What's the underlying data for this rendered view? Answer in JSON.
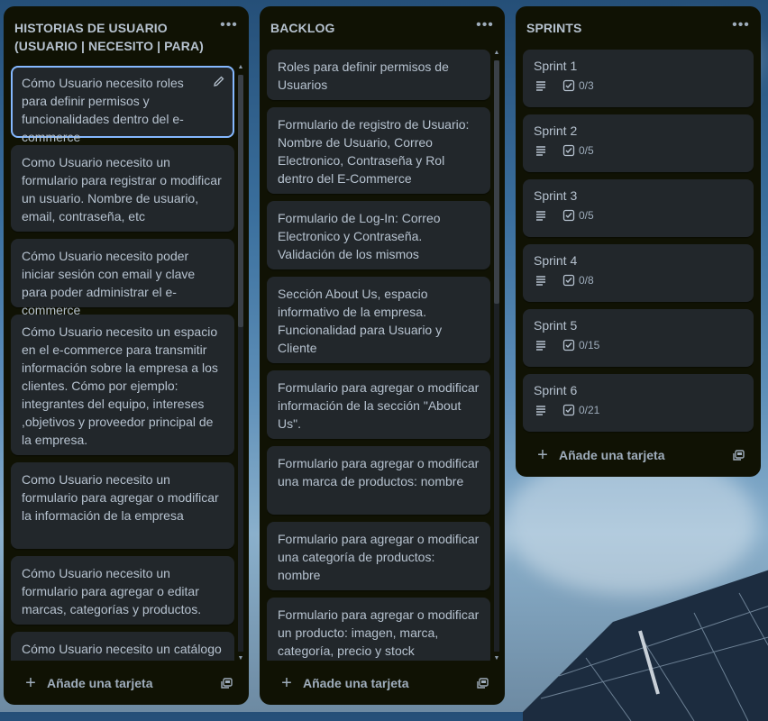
{
  "columns": [
    {
      "title": "HISTORIAS DE USUARIO (USUARIO | NECESITO | PARA)",
      "cards": [
        "Cómo Usuario necesito roles para definir permisos y funcionalidades dentro del e-commerce",
        "Como Usuario necesito un formulario para registrar o modificar un usuario. Nombre de usuario, email, contraseña, etc",
        "Cómo Usuario necesito poder iniciar sesión con email y clave para poder administrar el e-commerce",
        "Cómo Usuario necesito un espacio en el e-commerce para transmitir información sobre la empresa a los clientes. Cómo por ejemplo: integrantes del equipo, intereses ,objetivos y proveedor principal de la empresa.",
        "Como Usuario necesito un formulario para agregar o modificar la información de la empresa",
        "Cómo Usuario necesito un formulario para agregar o editar marcas, categorías y productos.",
        "Cómo Usuario necesito un catálogo con un listado de productos"
      ],
      "add_label": "Añade una tarjeta"
    },
    {
      "title": "BACKLOG",
      "cards": [
        "Roles para definir permisos de Usuarios",
        "Formulario de registro de Usuario: Nombre de Usuario, Correo Electronico, Contraseña y Rol dentro del E-Commerce",
        "Formulario de Log-In: Correo Electronico y Contraseña. Validación de los mismos",
        "Sección About Us, espacio informativo de la empresa. Funcionalidad para Usuario y Cliente",
        "Formulario para agregar o modificar información de la sección \"About Us\".",
        "Formulario para agregar o modificar una marca de productos: nombre",
        "Formulario para agregar o modificar una categoría de productos: nombre",
        "Formulario para agregar o modificar un producto: imagen, marca, categoría, precio y stock"
      ],
      "add_label": "Añade una tarjeta"
    },
    {
      "title": "SPRINTS",
      "cards": [
        {
          "name": "Sprint 1",
          "checklist": "0/3"
        },
        {
          "name": "Sprint 2",
          "checklist": "0/5"
        },
        {
          "name": "Sprint 3",
          "checklist": "0/5"
        },
        {
          "name": "Sprint 4",
          "checklist": "0/8"
        },
        {
          "name": "Sprint 5",
          "checklist": "0/15"
        },
        {
          "name": "Sprint 6",
          "checklist": "0/21"
        }
      ],
      "add_label": "Añade una tarjeta"
    }
  ],
  "icons": {
    "list_menu": "more-horizontal-icon",
    "card_edit": "pencil-icon",
    "add": "plus-icon",
    "template": "card-template-icon",
    "description": "description-lines-icon",
    "checklist": "checkbox-icon"
  },
  "colors": {
    "list_bg": "#101204",
    "card_bg": "#22272b",
    "text": "#b6c2cf",
    "selected_border": "#85b8ff"
  }
}
